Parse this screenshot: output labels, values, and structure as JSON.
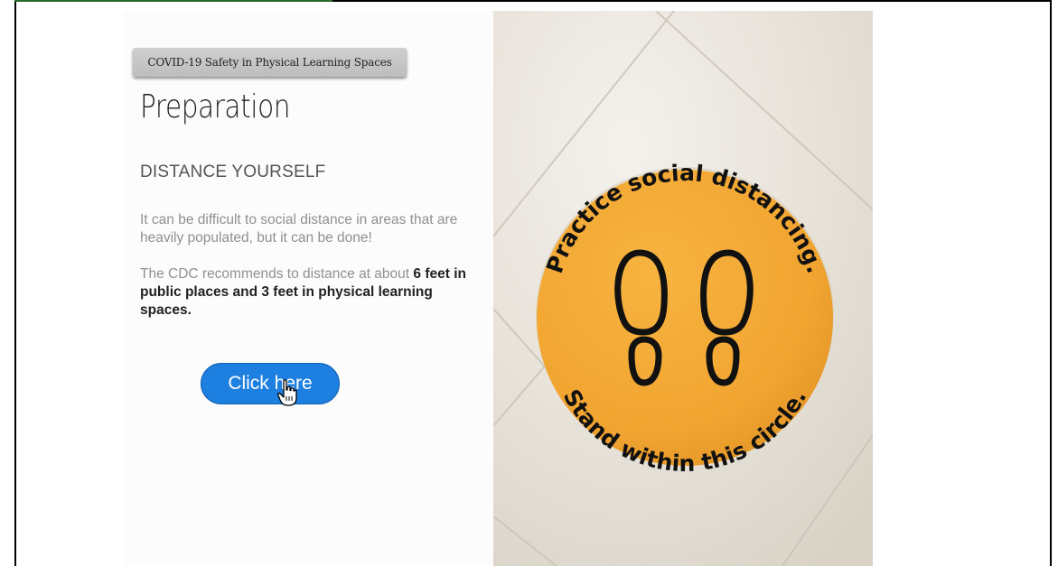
{
  "course": {
    "tag": "COVID-19 Safety in Physical Learning Spaces"
  },
  "lesson": {
    "title": "Preparation",
    "section_heading": "DISTANCE YOURSELF",
    "paragraph1": "It can be difficult to social distance in areas that are heavily populated, but it can be done!",
    "paragraph2_lead": "The CDC recommends to distance at about ",
    "paragraph2_bold": "6 feet in public places and 3 feet in physical learning spaces."
  },
  "cta": {
    "label": "Click here"
  },
  "photo": {
    "sign_top_text": "Practice social distancing.",
    "sign_bottom_text": "Stand within this circle.",
    "sign_color": "#f2a531"
  },
  "colors": {
    "button": "#1d7fe0",
    "accent_bar": "#2d6a2d"
  },
  "icons": [
    "hand-pointer-cursor-icon",
    "footprint-icon"
  ]
}
